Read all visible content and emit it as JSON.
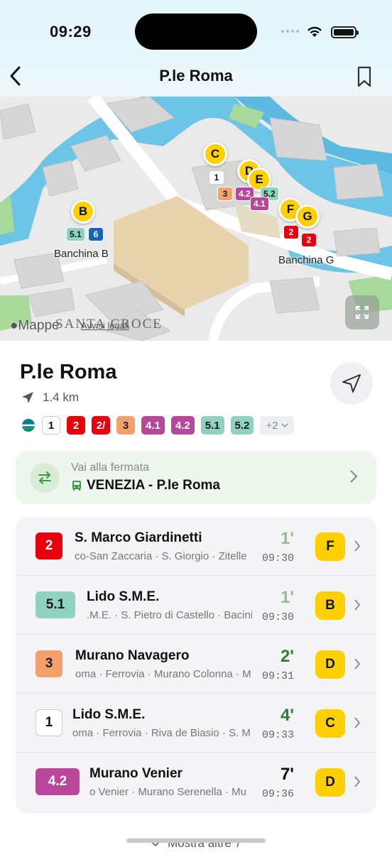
{
  "status": {
    "time": "09:29"
  },
  "nav": {
    "title": "P.le Roma"
  },
  "map": {
    "pins": [
      "C",
      "D",
      "E",
      "F",
      "G",
      "B"
    ],
    "line_chips": [
      "1",
      "3",
      "4.2",
      "5.2",
      "4.1",
      "2",
      "2",
      "5.1",
      "6"
    ],
    "label_b": "Banchina B",
    "label_g": "Banchina G",
    "district": "SANTA CROCE",
    "attribution": "Mappe",
    "legal": "Avvisi legali"
  },
  "stop": {
    "name": "P.le Roma",
    "distance": "1.4 km",
    "lines": [
      {
        "label": "1",
        "bg": "#ffffff",
        "fg": "#111111",
        "outline": true
      },
      {
        "label": "2",
        "bg": "#e8000b",
        "fg": "#ffffff"
      },
      {
        "label": "2/",
        "bg": "#e8000b",
        "fg": "#ffffff"
      },
      {
        "label": "3",
        "bg": "#f4a06a",
        "fg": "#222222"
      },
      {
        "label": "4.1",
        "bg": "#b8479b",
        "fg": "#ffffff"
      },
      {
        "label": "4.2",
        "bg": "#b8479b",
        "fg": "#ffffff"
      },
      {
        "label": "5.1",
        "bg": "#8fd2c0",
        "fg": "#1a1a1a"
      },
      {
        "label": "5.2",
        "bg": "#8fd2c0",
        "fg": "#1a1a1a"
      }
    ],
    "more_lines": "+2"
  },
  "goto": {
    "label": "Vai alla fermata",
    "destination": "VENEZIA - P.le Roma"
  },
  "departures": [
    {
      "line": "2",
      "bg": "#e8000b",
      "fg": "#ffffff",
      "destination": "S. Marco Giardinetti",
      "stops": "co-San Zaccaria · S. Giorgio · Zitelle",
      "minutes": "1'",
      "minutes_color": "#8fbf93",
      "clock": "09:30",
      "platform": "F"
    },
    {
      "line": "5.1",
      "bg": "#8fd2c0",
      "fg": "#1a1a1a",
      "destination": "Lido S.M.E.",
      "stops": ".M.E. · S. Pietro di Castello · Bacini",
      "minutes": "1'",
      "minutes_color": "#8fbf93",
      "clock": "09:30",
      "platform": "B"
    },
    {
      "line": "3",
      "bg": "#f4a06a",
      "fg": "#222222",
      "destination": "Murano Navagero",
      "stops": "oma · Ferrovia · Murano Colonna · M",
      "minutes": "2'",
      "minutes_color": "#2e7d3a",
      "clock": "09:31",
      "platform": "D"
    },
    {
      "line": "1",
      "bg": "#ffffff",
      "fg": "#111111",
      "outline": true,
      "destination": "Lido S.M.E.",
      "stops": "oma · Ferrovia · Riva de Biasio · S. M",
      "minutes": "4'",
      "minutes_color": "#2e7d3a",
      "clock": "09:33",
      "platform": "C"
    },
    {
      "line": "4.2",
      "bg": "#b8479b",
      "fg": "#ffffff",
      "destination": "Murano Venier",
      "stops": "o Venier · Murano Serenella · Mu",
      "minutes": "7'",
      "minutes_color": "#111111",
      "clock": "09:36",
      "platform": "D"
    }
  ],
  "show_more": "Mostra altre 7"
}
